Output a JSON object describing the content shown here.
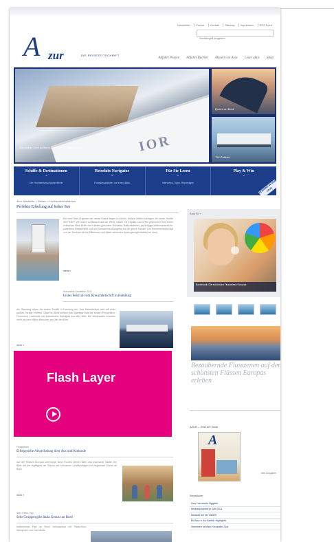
{
  "header": {
    "utility_links": [
      "Newsletter",
      "Presse",
      "Kontakt",
      "Sitemap",
      "Impressum",
      "RSS Feed"
    ],
    "search_placeholder": "Suchbegriff eingeben",
    "logo_script": "A",
    "logo_word": "zur",
    "logo_tagline": "DIE REISEZEITSCHRIFT",
    "main_nav": [
      "Abfahrt Planen",
      "Abfahrt Buchen",
      "Aktuell von Azur",
      "Leser aktiv",
      "Shop"
    ]
  },
  "hero": {
    "main_caption": "Rundlicher Chef an Bord: AIDA auf der Meyer Werft",
    "stamp": "IOR",
    "thumb1_caption": "Queen an Bord",
    "thumb2_caption": "TUI Cruises"
  },
  "tiles": [
    {
      "title": "Schiffe & Destinationen",
      "sub": "Der Hochseekreuzfahrtenführer"
    },
    {
      "title": "Reisehits Navigator",
      "sub": "Flusskreuzfahrten auf einen Blick"
    },
    {
      "title": "Für Sie Lesen",
      "sub": "Interviews, Tipps, Reportagen"
    },
    {
      "title": "Play & Win",
      "sub": "",
      "ribbon": "GEWINNE IN DER AZUR"
    }
  ],
  "content": {
    "breadcrumb": "Azur-Startseite > Reisen > Hochseekreuzfahrten",
    "headline1": "Perfekte Erholung auf hoher See",
    "article1": "Die zwei Stahl-Giganten der neuen Klasse liegen vor Anker. Welche Wellen schlagen die neuen Schiffe der Flotte? Wir waren zu Besuch auf der Werft, haben mit Kapitän und Crew gesprochen und einen exklusiven Blick hinter die Kulissen geworfen. Mit dabei: Balkonkabinen, großzügige Wellnessbereiche, zahlreiche Restaurants und ein Entertainment-Angebot für die ganze Familie. Die Premierenfahrt führt von der Nordsee bis ins Mittelmeer und bietet zahlreiche Ausflugsmöglichkeiten an Land.",
    "more": "mehr »",
    "small_date": "Kreuzfahrt-Neuheiten 2011",
    "headline2": "Erstes Festival vom Kreuzfahrtschiff in Hamburg",
    "article2": "Am Samstag reisen die ersten Schiffe in Hamburg ein. Das Hafenfestival wird mit einer großen Parade eröffnet. Gäste an Bord erleben das Spektakel aus der besten Perspektive: Feuerwerk, Livemusik und kulinarische Highlights aus aller Welt. Die Veranstalter erwarten mehr als eine Million Besucher am Ufer der Elbe.",
    "small3": "Flussreisen",
    "headline3": "Erfolgreiche Abwechslung über Aus und Kleinode",
    "article3": "Auf den Flüssen Europas unterwegs: Neue Routen, kleine Häfen und charmante Städte. Ein Blick auf die Highlights der Saison mit exklusiven Landausflügen und regionaler Küche an Bord.",
    "small4": "Azur Reise-Tipp",
    "headline4": "Sehr Gruppen gibt Italia Genuss an Bord",
    "article4": "Italienisches Flair an Bord: Genussreise mit Pasta-Kurs, Weinprobe und Live-Musik."
  },
  "flash": {
    "label": "Flash Layer"
  },
  "sidebar": {
    "video_label": "AzurTV +",
    "video_caption": "Bordmusik: Die schönsten Flussreisen Europas",
    "promo_text": "Bezaubernde Flusszenen auf den schönsten Flüssen Europas erleben",
    "mag_label": "AZUR – Jetzt am Kiosk",
    "mag_more": "Alle Ausgaben",
    "news_label": "Newsticker",
    "news_items": [
      "Azur Leserreise: Ägypten",
      "Neubauprojekte im Jahr 2011",
      "Neustart auf der Ostsee",
      "Mit Azur in die Karibik: Highlights",
      "Seereisen mit Azur Kreuzfahrt-Tipp"
    ]
  }
}
